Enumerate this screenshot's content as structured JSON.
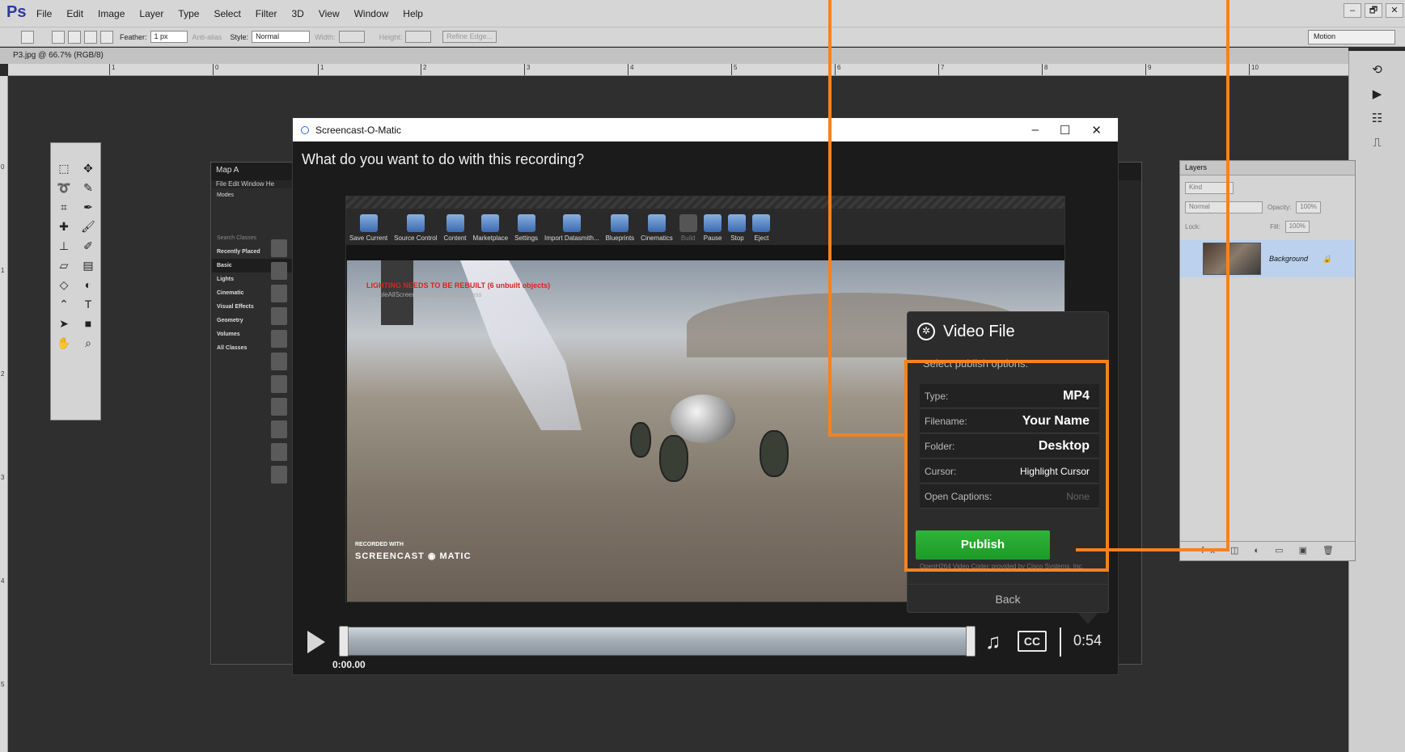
{
  "ps": {
    "logo": "Ps",
    "menu": [
      "File",
      "Edit",
      "Image",
      "Layer",
      "Type",
      "Select",
      "Filter",
      "3D",
      "View",
      "Window",
      "Help"
    ],
    "window_controls": [
      "–",
      "🗗",
      "✕"
    ],
    "options": {
      "feather_label": "Feather:",
      "feather_value": "1 px",
      "antialias": "Anti-alias",
      "style_label": "Style:",
      "style_value": "Normal",
      "width_label": "Width:",
      "height_label": "Height:",
      "refine": "Refine Edge..."
    },
    "workspace": "Motion",
    "doc_tab": "P3.jpg @ 66.7% (RGB/8)",
    "ruler_h": [
      "1",
      "0",
      "1",
      "2",
      "3",
      "4",
      "5",
      "6",
      "7",
      "8",
      "9",
      "10"
    ],
    "ruler_v": [
      "0",
      "1",
      "2",
      "3",
      "4",
      "5"
    ]
  },
  "layers": {
    "title": "Layers",
    "kind": "Kind",
    "blend": "Normal",
    "opacity_label": "Opacity:",
    "opacity_value": "100%",
    "lock_label": "Lock:",
    "fill_label": "Fill:",
    "fill_value": "100%",
    "background_layer": "Background"
  },
  "unreal": {
    "tab": "Map A",
    "menu": "File  Edit  Window  He",
    "modes_title": "Modes",
    "search": "Search Classes",
    "categories": [
      "Recently Placed",
      "Basic",
      "Lights",
      "Cinematic",
      "Visual Effects",
      "Geometry",
      "Volumes",
      "All Classes"
    ]
  },
  "screencast": {
    "title": "Screencast-O-Matic",
    "controls": [
      "–",
      "☐",
      "✕"
    ],
    "question": "What do you want to do with this recording?",
    "ue_toolbar": [
      "Save Current",
      "Source Control",
      "Content",
      "Marketplace",
      "Settings",
      "Import Datasmith...",
      "Blueprints",
      "Cinematics",
      "Build",
      "Pause",
      "Stop",
      "Eject"
    ],
    "lighting_warning": "LIGHTING NEEDS TO BE REBUILT (6 unbuilt objects)",
    "lighting_hint": "DisableAllScreenMessages' to suppress",
    "watermark_line1": "RECORDED WITH",
    "watermark_line2": "SCREENCAST ◉ MATIC",
    "time_start": "0:00.00",
    "duration": "0:54",
    "cc": "CC"
  },
  "video_file": {
    "title": "Video File",
    "subtitle": "Select publish options:",
    "options": [
      {
        "label": "Type:",
        "value": "MP4"
      },
      {
        "label": "Filename:",
        "value": "Your Name"
      },
      {
        "label": "Folder:",
        "value": "Desktop"
      },
      {
        "label": "Cursor:",
        "value": "Highlight Cursor"
      },
      {
        "label": "Open Captions:",
        "value": "None"
      }
    ],
    "publish": "Publish",
    "codec": "OpenH264 Video Codec provided by Cisco Systems, Inc.",
    "back": "Back"
  },
  "colors": {
    "annotation": "#f5821f",
    "publish_green": "#22a82d"
  }
}
